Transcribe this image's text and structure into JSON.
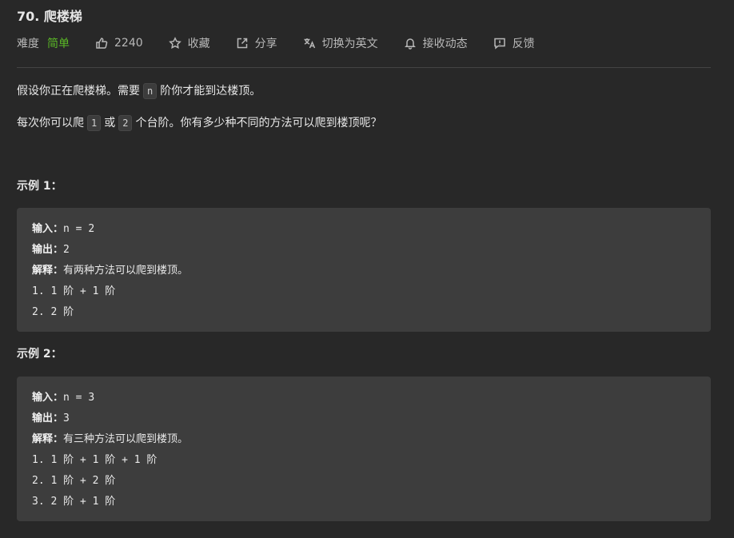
{
  "problem": {
    "title": "70. 爬楼梯"
  },
  "meta": {
    "difficulty_label": "难度",
    "difficulty_value": "简单",
    "difficulty_color": "#5ab726",
    "likes": "2240",
    "favorite_label": "收藏",
    "share_label": "分享",
    "translate_label": "切换为英文",
    "subscribe_label": "接收动态",
    "feedback_label": "反馈"
  },
  "description": {
    "p1_before": "假设你正在爬楼梯。需要",
    "p1_code": "n",
    "p1_after": "阶你才能到达楼顶。",
    "p2_before": "每次你可以爬",
    "p2_code1": "1",
    "p2_middle": "或",
    "p2_code2": "2",
    "p2_after": "个台阶。你有多少种不同的方法可以爬到楼顶呢？"
  },
  "examples": [
    {
      "title": "示例 1：",
      "input_label": "输入：",
      "input_value": "n = 2",
      "output_label": "输出：",
      "output_value": "2",
      "explain_label": "解释：",
      "explain_value": "有两种方法可以爬到楼顶。",
      "steps": [
        "1. 1 阶 + 1 阶",
        "2. 2 阶"
      ]
    },
    {
      "title": "示例 2：",
      "input_label": "输入：",
      "input_value": "n = 3",
      "output_label": "输出：",
      "output_value": "3",
      "explain_label": "解释：",
      "explain_value": "有三种方法可以爬到楼顶。",
      "steps": [
        "1. 1 阶 + 1 阶 + 1 阶",
        "2. 1 阶 + 2 阶",
        "3. 2 阶 + 1 阶"
      ]
    }
  ]
}
